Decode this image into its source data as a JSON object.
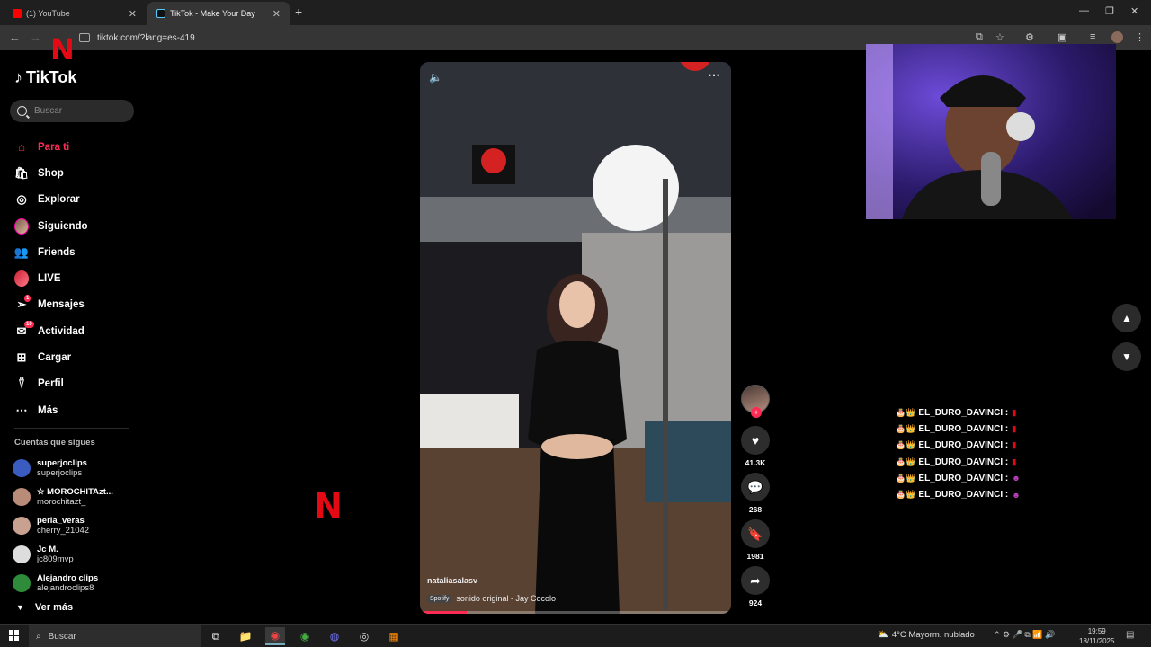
{
  "browser": {
    "tabs": [
      {
        "title": "(1) YouTube",
        "favicon_color": "#ff0000"
      },
      {
        "title": "TikTok - Make Your Day",
        "favicon_color": "#000000"
      }
    ],
    "url": "tiktok.com/?lang=es-419"
  },
  "tiktok": {
    "logo_text": "TikTok",
    "search_placeholder": "Buscar",
    "menu": [
      {
        "label": "Para ti",
        "icon": "home-icon",
        "active": true
      },
      {
        "label": "Shop",
        "icon": "shopping-bag-icon"
      },
      {
        "label": "Explorar",
        "icon": "compass-icon"
      },
      {
        "label": "Siguiendo",
        "icon": "avatar-icon"
      },
      {
        "label": "Friends",
        "icon": "friends-icon"
      },
      {
        "label": "LIVE",
        "icon": "live-icon"
      },
      {
        "label": "Mensajes",
        "icon": "send-icon",
        "badge": "1"
      },
      {
        "label": "Actividad",
        "icon": "inbox-icon",
        "badge": "10"
      },
      {
        "label": "Cargar",
        "icon": "upload-icon"
      },
      {
        "label": "Perfil",
        "icon": "profile-icon"
      },
      {
        "label": "Más",
        "icon": "more-icon"
      }
    ],
    "following_header": "Cuentas que sigues",
    "following": [
      {
        "name": "superjoclips",
        "username": "superjoclips",
        "color": "#3a5bbf"
      },
      {
        "name": "☆ MOROCHITAzt...",
        "username": "morochitazt_",
        "color": "#b98c7a"
      },
      {
        "name": "perla_veras",
        "username": "cherry_21042",
        "color": "#c9a190"
      },
      {
        "name": "Jc M.",
        "username": "jc809mvp",
        "color": "#dddddd"
      },
      {
        "name": "Alejandro clips",
        "username": "alejandroclips8",
        "color": "#2e8b3a"
      }
    ],
    "see_more": "Ver más"
  },
  "video": {
    "author": "nataliasalasv",
    "music_badge": "Spotify",
    "music": "sonido original - Jay Cocolo",
    "progress": 0.15
  },
  "actions": {
    "likes": "41.3K",
    "comments": "268",
    "saves": "1981",
    "shares": "924"
  },
  "chat": [
    {
      "user": "EL_DURO_DAVINCI :",
      "tail": "▮",
      "tail_color": "#e50914"
    },
    {
      "user": "EL_DURO_DAVINCI :",
      "tail": "▮",
      "tail_color": "#e50914"
    },
    {
      "user": "EL_DURO_DAVINCI :",
      "tail": "▮",
      "tail_color": "#e50914"
    },
    {
      "user": "EL_DURO_DAVINCI :",
      "tail": "▮",
      "tail_color": "#e50914"
    },
    {
      "user": "EL_DURO_DAVINCI :",
      "tail": "☻",
      "tail_color": "#c040c0"
    },
    {
      "user": "EL_DURO_DAVINCI :",
      "tail": "☻",
      "tail_color": "#c040c0"
    }
  ],
  "taskbar": {
    "search": "Buscar",
    "weather": "4°C  Mayorm. nublado",
    "time": "19:59",
    "date": "18/11/2025"
  },
  "colors": {
    "accent": "#fe2c55",
    "netflix": "#e50914"
  }
}
